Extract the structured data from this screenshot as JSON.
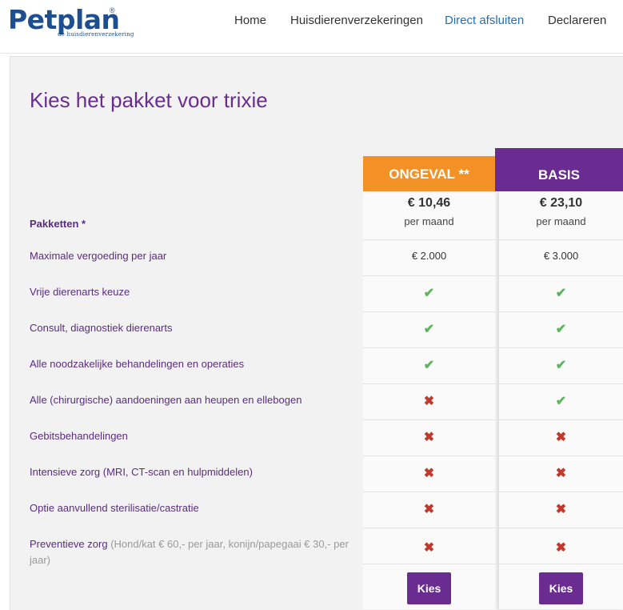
{
  "brand": {
    "name": "Petplan",
    "reg": "®",
    "tagline": "de huisdierenverzekering"
  },
  "nav": [
    {
      "label": "Home"
    },
    {
      "label": "Huisdierenverzekeringen"
    },
    {
      "label": "Direct afsluiten",
      "active": true
    },
    {
      "label": "Declareren"
    }
  ],
  "page": {
    "title": "Kies het pakket voor trixie"
  },
  "packages_label": "Pakketten *",
  "plans": [
    {
      "name": "ONGEVAL **",
      "price": "€ 10,46",
      "period": "per maand",
      "max": "€ 2.000",
      "button": "Kies",
      "color": "#f39026"
    },
    {
      "name": "BASIS",
      "price": "€ 23,10",
      "period": "per maand",
      "max": "€ 3.000",
      "button": "Kies",
      "color": "#6a2c91"
    }
  ],
  "features": [
    {
      "label": "Maximale vergoeding per jaar"
    },
    {
      "label": "Vrije dierenarts keuze",
      "plan1": "check-icon",
      "plan2": "check-icon"
    },
    {
      "label": "Consult, diagnostiek dierenarts",
      "plan1": "check-icon",
      "plan2": "check-icon"
    },
    {
      "label": "Alle noodzakelijke behandelingen en operaties",
      "plan1": "check-icon",
      "plan2": "check-icon"
    },
    {
      "label": "Alle (chirurgische) aandoeningen aan heupen en ellebogen",
      "plan1": "cross-icon",
      "plan2": "check-icon"
    },
    {
      "label": "Gebitsbehandelingen",
      "plan1": "cross-icon",
      "plan2": "cross-icon"
    },
    {
      "label": "Intensieve zorg (MRI, CT-scan en hulpmiddelen)",
      "plan1": "cross-icon",
      "plan2": "cross-icon"
    },
    {
      "label": "Optie aanvullend sterilisatie/castratie",
      "plan1": "cross-icon",
      "plan2": "cross-icon"
    },
    {
      "label": "Preventieve zorg",
      "note": "(Hond/kat € 60,- per jaar, konijn/papegaai € 30,- per jaar)",
      "plan1": "cross-icon",
      "plan2": "cross-icon"
    }
  ],
  "icons": {
    "check": "✔",
    "cross": "✖"
  }
}
